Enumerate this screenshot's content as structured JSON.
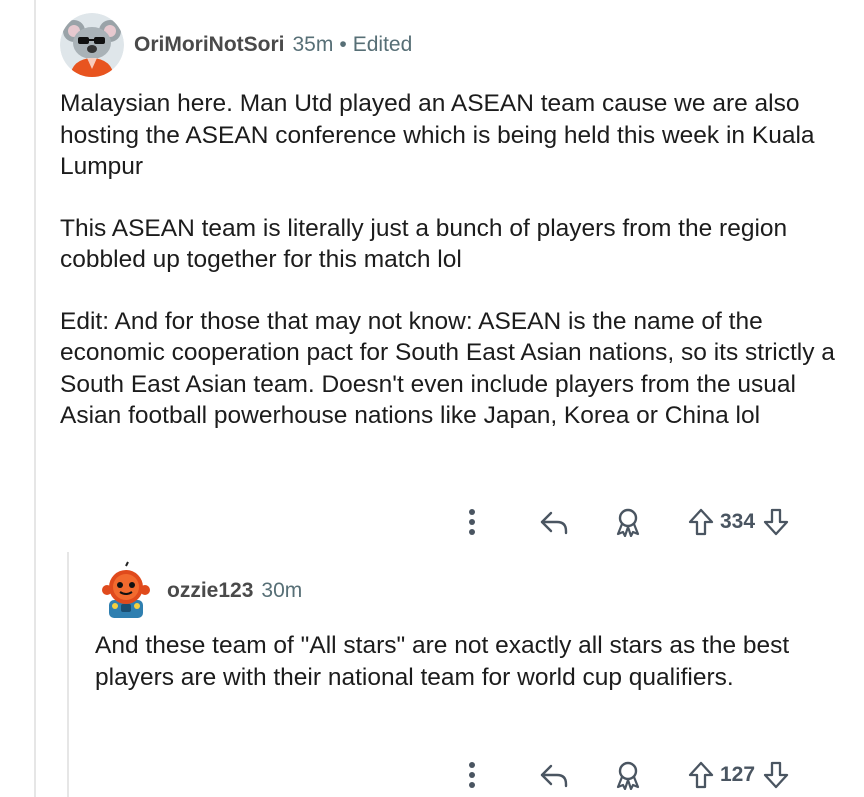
{
  "comments": [
    {
      "author": "OriMoriNotSori",
      "time": "35m",
      "separator": "•",
      "edited": "Edited",
      "avatar_icon": "koala-avatar-icon",
      "paragraphs": [
        "Malaysian here. Man Utd played an ASEAN team cause we are also hosting the ASEAN conference which is being held this week in Kuala Lumpur",
        "This ASEAN team is literally just a bunch of players from the region cobbled up together for this match lol",
        "Edit: And for those that may not know: ASEAN is the name of the economic cooperation pact for South East Asian nations, so its strictly a South East Asian team. Doesn't even include players from the usual Asian football powerhouse nations like Japan, Korea or China lol"
      ],
      "score": "334"
    },
    {
      "author": "ozzie123",
      "time": "30m",
      "avatar_icon": "robot-avatar-icon",
      "paragraphs": [
        "And these team of \"All stars\" are not exactly all stars as the best players are with their national team for world cup qualifiers."
      ],
      "score": "127"
    }
  ],
  "colors": {
    "meta_gray": "#576f76",
    "text": "#1c1c1c",
    "thread_line": "#e6e6e6"
  }
}
